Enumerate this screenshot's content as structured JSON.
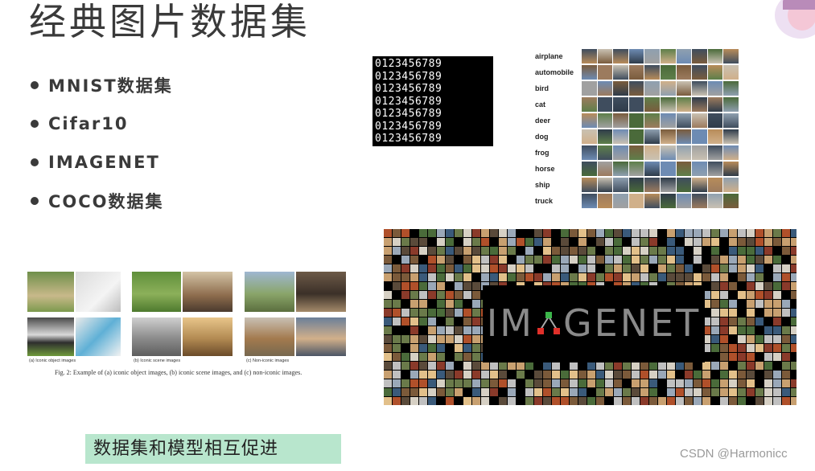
{
  "title": "经典图片数据集",
  "bullets": [
    "MNIST数据集",
    "Cifar10",
    "IMAGENET",
    "COCO数据集"
  ],
  "mnist": {
    "rows": [
      "0123456789",
      "0123456789",
      "0123456789",
      "0123456789",
      "0123456789",
      "0123456789",
      "0123456789"
    ]
  },
  "cifar": {
    "labels": [
      "airplane",
      "automobile",
      "bird",
      "cat",
      "deer",
      "dog",
      "frog",
      "horse",
      "ship",
      "truck"
    ]
  },
  "coco": {
    "captions": [
      "(a) Iconic object images",
      "(b) Iconic scene images",
      "(c) Non-iconic images"
    ],
    "figure_caption": "Fig. 2: Example of (a) iconic object images, (b) iconic scene images, and (c) non-iconic images."
  },
  "imagenet": {
    "logo_left": "IM",
    "logo_right": "GENET"
  },
  "note": "数据集和模型相互促进",
  "watermark": "CSDN @Harmonicc",
  "colors": {
    "note_bg": "#b8e6cd",
    "title": "#3a3a3a"
  }
}
